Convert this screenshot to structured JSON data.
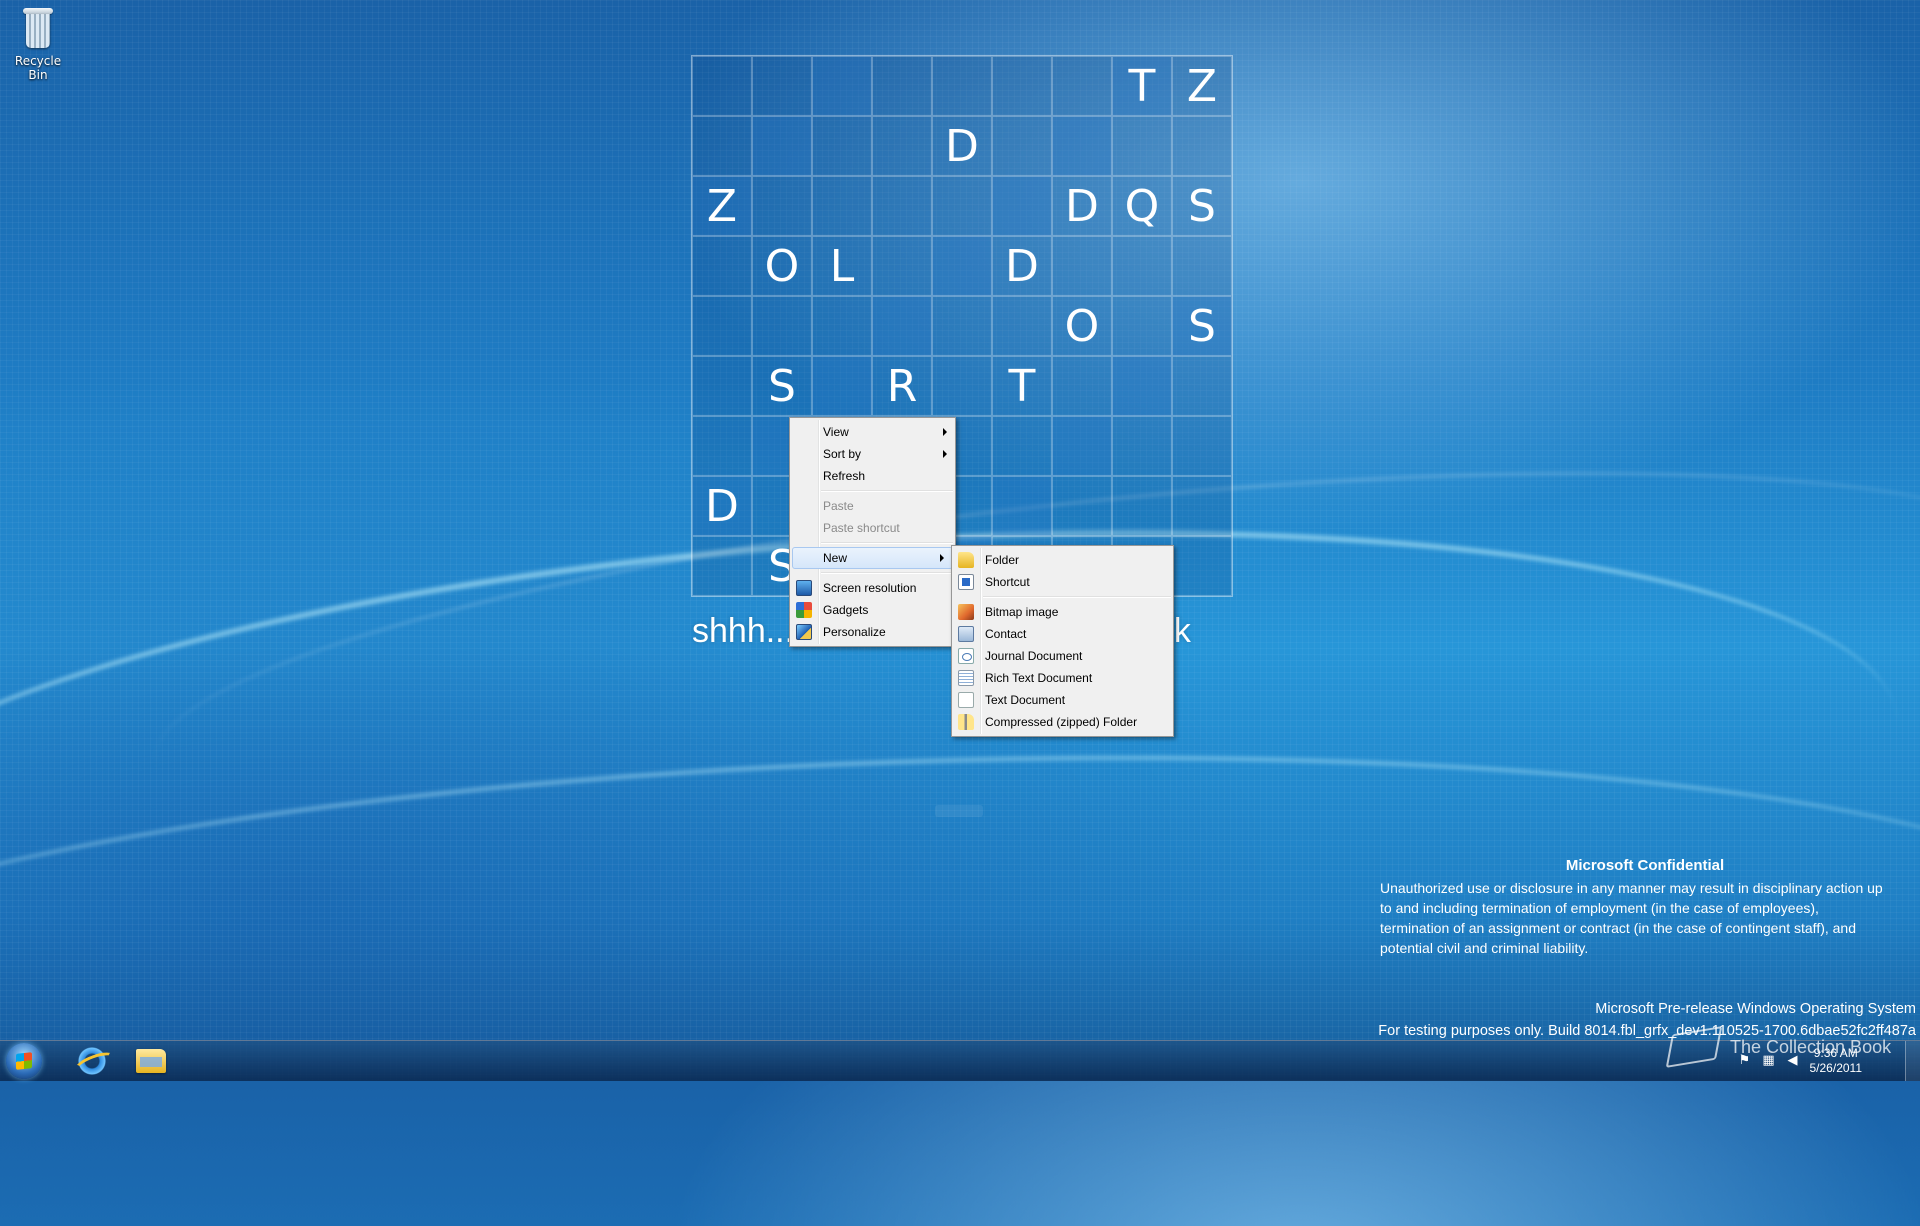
{
  "desktop": {
    "icons": [
      {
        "label": "Recycle Bin",
        "icon": "recycle-bin-icon"
      }
    ]
  },
  "board": {
    "rows": [
      [
        "",
        "",
        "",
        "",
        "",
        "",
        "",
        "T",
        "Z"
      ],
      [
        "",
        "",
        "",
        "",
        "D",
        "",
        "",
        "",
        ""
      ],
      [
        "Z",
        "",
        "",
        "",
        "",
        "",
        "D",
        "Q",
        "S"
      ],
      [
        "",
        "O",
        "L",
        "",
        "",
        "D",
        "",
        "",
        ""
      ],
      [
        "",
        "",
        "",
        "",
        "",
        "",
        "O",
        "",
        "S"
      ],
      [
        "",
        "S",
        "",
        "R",
        "",
        "T",
        "",
        "",
        ""
      ],
      [
        "",
        "",
        "",
        "",
        "",
        "",
        "",
        "",
        ""
      ],
      [
        "D",
        "",
        "",
        "",
        "",
        "",
        "",
        "",
        ""
      ],
      [
        "",
        "S",
        "",
        "",
        "",
        "",
        "",
        "",
        ""
      ]
    ],
    "caption_left": "shhh...",
    "caption_right": "work"
  },
  "context_menu": {
    "items": [
      {
        "label": "View",
        "submenu": true
      },
      {
        "label": "Sort by",
        "submenu": true
      },
      {
        "label": "Refresh"
      },
      {
        "separator": true
      },
      {
        "label": "Paste",
        "disabled": true
      },
      {
        "label": "Paste shortcut",
        "disabled": true
      },
      {
        "separator": true
      },
      {
        "label": "New",
        "submenu": true,
        "active": true
      },
      {
        "separator": true
      },
      {
        "label": "Screen resolution",
        "icon": "screen-resolution-icon"
      },
      {
        "label": "Gadgets",
        "icon": "gadgets-icon"
      },
      {
        "label": "Personalize",
        "icon": "personalize-icon"
      }
    ]
  },
  "new_submenu": {
    "items": [
      {
        "label": "Folder",
        "icon": "folder-icon"
      },
      {
        "label": "Shortcut",
        "icon": "shortcut-icon"
      },
      {
        "separator": true
      },
      {
        "label": "Bitmap image",
        "icon": "bitmap-icon"
      },
      {
        "label": "Contact",
        "icon": "contact-icon"
      },
      {
        "label": "Journal Document",
        "icon": "journal-icon"
      },
      {
        "label": "Rich Text Document",
        "icon": "rich-text-icon"
      },
      {
        "label": "Text Document",
        "icon": "text-document-icon"
      },
      {
        "label": "Compressed (zipped) Folder",
        "icon": "zip-folder-icon"
      }
    ]
  },
  "confidential": {
    "title": "Microsoft Confidential",
    "lines": [
      "Unauthorized use or disclosure in any manner may result in disciplinary action up",
      "to and including termination of employment (in the case of employees),",
      "termination of an assignment or contract (in the case of contingent staff), and",
      "potential civil and criminal liability."
    ]
  },
  "build_info": {
    "line1": "Microsoft Pre-release Windows Operating System",
    "line2": "For testing purposes only. Build 8014.fbl_grfx_dev1.110525-1700.6dbae52fc2ff487a"
  },
  "taskbar": {
    "pinned": [
      {
        "name": "internet-explorer",
        "icon": "ie-icon"
      },
      {
        "name": "windows-explorer",
        "icon": "folder-icon"
      }
    ],
    "tray_icons": [
      "flag-icon",
      "network-icon",
      "volume-icon"
    ],
    "clock_time": "9:36 AM",
    "clock_date": "5/26/2011"
  },
  "watermark": {
    "text": "The Collection Book"
  }
}
